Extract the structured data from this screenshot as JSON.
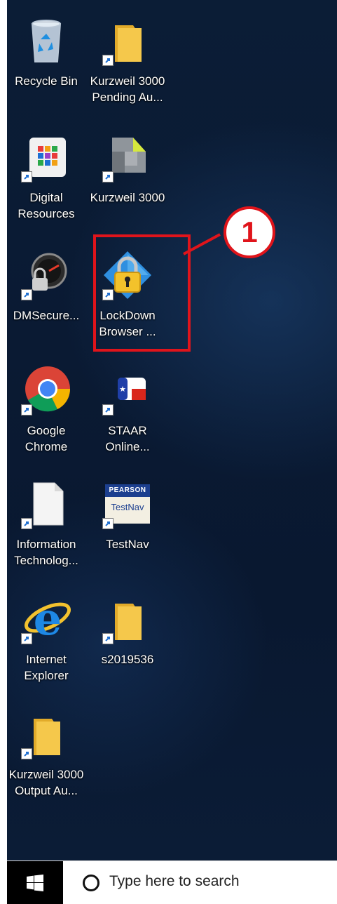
{
  "desktop": {
    "icons": [
      {
        "name": "recycle-bin",
        "line1": "Recycle Bin",
        "line2": ""
      },
      {
        "name": "kurzweil-3000-pending",
        "line1": "Kurzweil 3000",
        "line2": "Pending Au..."
      },
      {
        "name": "digital-resources",
        "line1": "Digital",
        "line2": "Resources"
      },
      {
        "name": "kurzweil-3000",
        "line1": "Kurzweil 3000",
        "line2": ""
      },
      {
        "name": "dmsecure",
        "line1": "DMSecure...",
        "line2": ""
      },
      {
        "name": "lockdown-browser",
        "line1": "LockDown",
        "line2": "Browser ..."
      },
      {
        "name": "google-chrome",
        "line1": "Google",
        "line2": "Chrome"
      },
      {
        "name": "staar-online",
        "line1": "STAAR",
        "line2": "Online..."
      },
      {
        "name": "information-technology",
        "line1": "Information",
        "line2": "Technolog..."
      },
      {
        "name": "testnav",
        "line1": "TestNav",
        "line2": "",
        "badge_top": "PEARSON",
        "badge_bottom": "TestNav"
      },
      {
        "name": "internet-explorer",
        "line1": "Internet",
        "line2": "Explorer"
      },
      {
        "name": "s2019536",
        "line1": "s2019536",
        "line2": ""
      },
      {
        "name": "kurzweil-3000-output",
        "line1": "Kurzweil 3000",
        "line2": "Output Au..."
      }
    ]
  },
  "annotation": {
    "number": "1",
    "color": "#e0141b"
  },
  "taskbar": {
    "search_placeholder": "Type here to search"
  },
  "colors": {
    "folder": "#f5c84b",
    "folder_dark": "#e2ab2a",
    "desktop_bg": "#0a1a33"
  }
}
